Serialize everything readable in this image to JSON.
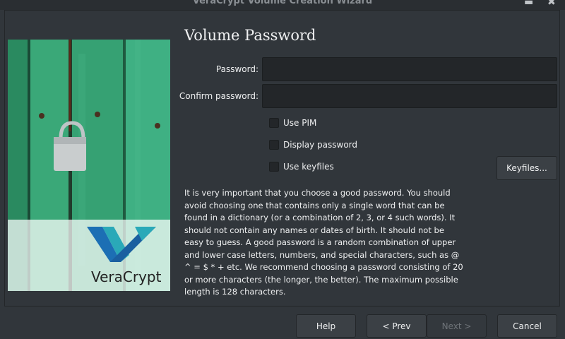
{
  "window": {
    "title": "VeraCrypt Volume Creation Wizard",
    "minimize_glyph": "▬",
    "close_glyph": "✖"
  },
  "side_image": {
    "brand": "VeraCrypt",
    "colors": {
      "wood": "#3aa57a",
      "wood_dark": "#2a7c5a",
      "logo_blue": "#1c6fb4",
      "logo_teal": "#2aa9b8"
    }
  },
  "page": {
    "heading": "Volume Password",
    "password_label": "Password:",
    "password_value": "",
    "confirm_label": "Confirm password:",
    "confirm_value": "",
    "checkboxes": [
      {
        "label": "Use PIM",
        "checked": false
      },
      {
        "label": "Display password",
        "checked": false
      },
      {
        "label": "Use keyfiles",
        "checked": false
      }
    ],
    "keyfiles_button": "Keyfiles...",
    "description": "It is very important that you choose a good password. You should avoid choosing one that contains only a single word that can be found in a dictionary (or a combination of 2, 3, or 4 such words). It should not contain any names or dates of birth. It should not be easy to guess. A good password is a random combination of upper and lower case letters, numbers, and special characters, such as @ ^ = $ * + etc. We recommend choosing a password consisting of 20 or more characters (the longer, the better). The maximum possible length is 128 characters."
  },
  "footer": {
    "help": "Help",
    "prev": "< Prev",
    "next": "Next >",
    "cancel": "Cancel"
  }
}
